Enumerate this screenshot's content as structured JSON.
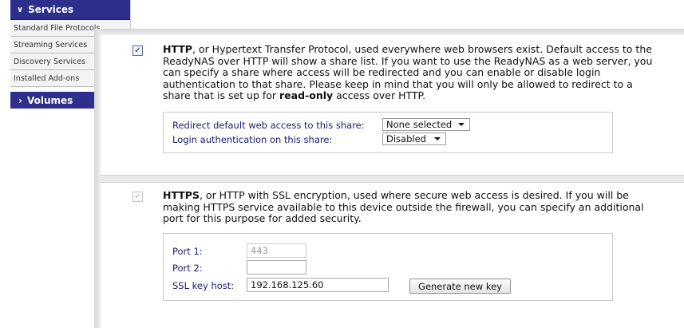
{
  "sidebar": {
    "header": "Services",
    "header_icon": "chevron-down-icon",
    "items": [
      {
        "label": "Standard File Protocols"
      },
      {
        "label": "Streaming Services"
      },
      {
        "label": "Discovery Services"
      },
      {
        "label": "Installed Add-ons"
      }
    ],
    "volumes": "Volumes",
    "volumes_icon": "chevron-right-icon"
  },
  "http": {
    "checked": true,
    "title": "HTTP",
    "desc_a": ", or Hypertext Transfer Protocol, used everywhere web browsers exist. Default access to the ReadyNAS over HTTP will show a share list. If you want to use the ReadyNAS as a web server, you can specify a share where access will be redirected and you can enable or disable login authentication to that share. Please keep in mind that you will only be allowed to redirect to a share that is set up for ",
    "desc_bold": "read-only",
    "desc_b": " access over HTTP.",
    "redirect_label": "Redirect default web access to this share:",
    "redirect_value": "None selected",
    "auth_label": "Login authentication on this share:",
    "auth_value": "Disabled"
  },
  "https": {
    "checked": true,
    "title": "HTTPS",
    "desc": ", or HTTP with SSL encryption, used where secure web access is desired. If you will be making HTTPS service available to this device outside the firewall, you can specify an additional port for this purpose for added security.",
    "port1_label": "Port 1:",
    "port1_value": "443",
    "port2_label": "Port 2:",
    "port2_value": "",
    "ssl_label": "SSL key host:",
    "ssl_value": "192.168.125.60",
    "generate_button": "Generate new key"
  },
  "colors": {
    "sidebar_header": "#2e2f8c",
    "label_text": "#1a1a6e"
  }
}
